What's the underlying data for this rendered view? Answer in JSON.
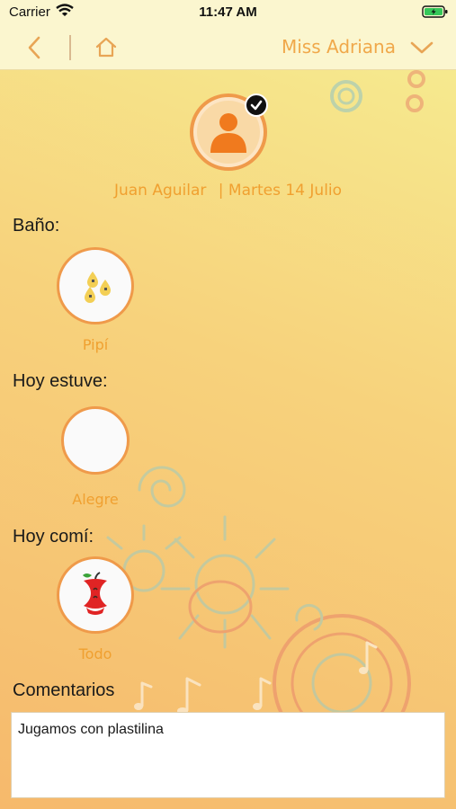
{
  "status_bar": {
    "carrier": "Carrier",
    "time": "11:47 AM",
    "wifi_icon": "wifi-icon",
    "battery_icon": "battery-charging-icon"
  },
  "nav": {
    "back_icon": "chevron-left-icon",
    "home_icon": "home-icon",
    "teacher_name": "Miss Adriana",
    "dropdown_icon": "chevron-down-icon"
  },
  "student": {
    "name": "Juan Aguilar",
    "date": "| Martes 14 Julio",
    "avatar_icon": "person-icon",
    "check_icon": "checkmark-icon"
  },
  "sections": {
    "bano": {
      "label": "Baño:",
      "selection": "Pipí",
      "icon": "drops-icon"
    },
    "hoy": {
      "label": "Hoy estuve:",
      "selection": "Alegre",
      "icon": "mood-icon"
    },
    "comi": {
      "label": "Hoy comí:",
      "selection": "Todo",
      "icon": "apple-core-icon"
    }
  },
  "comments": {
    "label": "Comentarios",
    "value": "Jugamos con plastilina"
  },
  "colors": {
    "accent": "#f0a030",
    "ring": "#ef9a4a",
    "avatar": "#f07a1e",
    "bar": "#fbf6cf"
  }
}
